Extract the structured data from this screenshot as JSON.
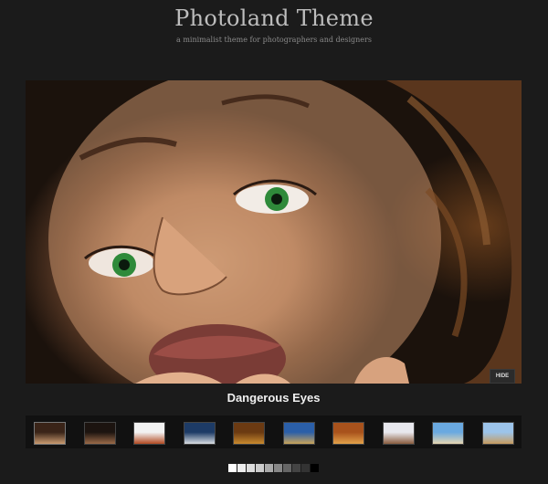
{
  "header": {
    "title": "Photoland Theme",
    "tagline": "a minimalist theme for photographers and designers"
  },
  "slideshow": {
    "caption": "Dangerous Eyes",
    "hide_label": "HIDE"
  },
  "thumbnails": [
    {
      "subject": "portrait-closeup",
      "colors": [
        "#3a2418",
        "#c99a70"
      ]
    },
    {
      "subject": "reclining-figure",
      "colors": [
        "#1c1410",
        "#9a6a48"
      ]
    },
    {
      "subject": "flower-on-white",
      "colors": [
        "#f2f2f2",
        "#b24a22"
      ]
    },
    {
      "subject": "blue-lake-landscape",
      "colors": [
        "#1d3b66",
        "#d9dde2"
      ]
    },
    {
      "subject": "autumn-field",
      "colors": [
        "#6b3a12",
        "#c98a2e"
      ]
    },
    {
      "subject": "blue-sky-hills",
      "colors": [
        "#2b5fa8",
        "#c9a45a"
      ]
    },
    {
      "subject": "orange-canyon",
      "colors": [
        "#a8521c",
        "#e3a24a"
      ]
    },
    {
      "subject": "people-on-rocks",
      "colors": [
        "#e8e8ee",
        "#8a5c3e"
      ]
    },
    {
      "subject": "sky-and-sand",
      "colors": [
        "#6aa9e0",
        "#e6d6b0"
      ]
    },
    {
      "subject": "pyramids",
      "colors": [
        "#9cc4ea",
        "#c79b5e"
      ]
    }
  ],
  "pager": {
    "colors": [
      "#ffffff",
      "#eeeeee",
      "#dddddd",
      "#cccccc",
      "#aaaaaa",
      "#888888",
      "#666666",
      "#444444",
      "#333333",
      "#000000"
    ]
  }
}
